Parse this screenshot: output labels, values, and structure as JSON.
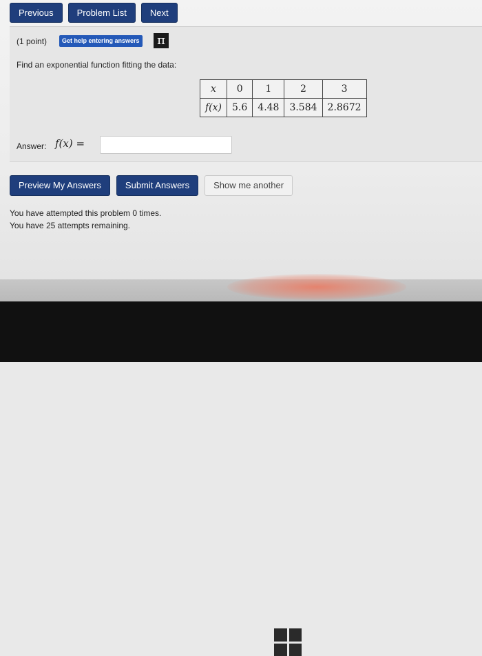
{
  "nav": {
    "previous": "Previous",
    "problem_list": "Problem List",
    "next": "Next"
  },
  "problem": {
    "points": "(1 point)",
    "help_button": "Get help entering answers",
    "pi_icon": "π",
    "prompt": "Find an exponential function fitting the data:",
    "table": {
      "header_label": "x",
      "header_values": [
        "0",
        "1",
        "2",
        "3"
      ],
      "row_label": "f(x)",
      "row_values": [
        "5.6",
        "4.48",
        "3.584",
        "2.8672"
      ]
    },
    "answer_label": "Answer:",
    "answer_expression": "f(x) =",
    "answer_value": ""
  },
  "actions": {
    "preview": "Preview My Answers",
    "submit": "Submit Answers",
    "show_another": "Show me another"
  },
  "status": {
    "attempted": "You have attempted this problem 0 times.",
    "remaining": "You have 25 attempts remaining."
  },
  "colors": {
    "primary_button": "#1f3e7c",
    "help_button": "#2459b8"
  }
}
